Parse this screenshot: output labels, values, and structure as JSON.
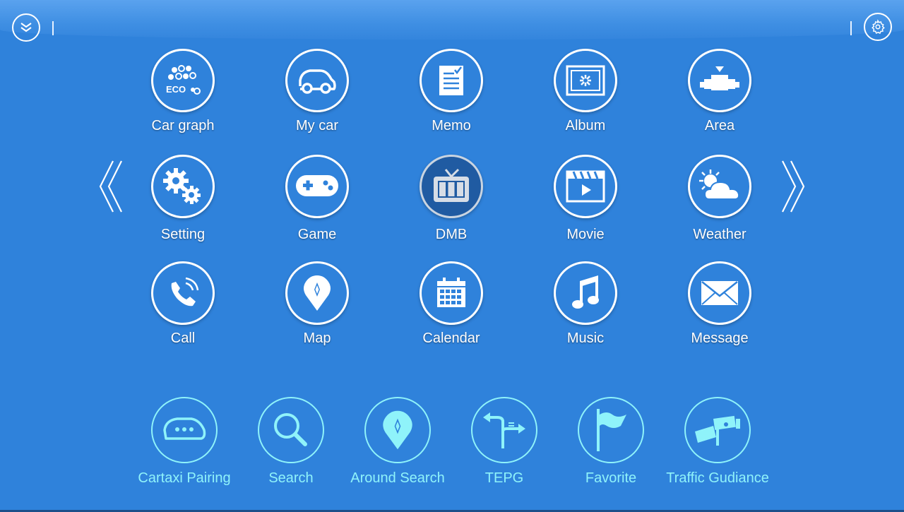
{
  "topbar": {
    "expand_icon": "double-chevron-down-icon",
    "settings_icon": "gear-icon"
  },
  "nav": {
    "prev_icon": "chevron-left-icon",
    "next_icon": "chevron-right-icon"
  },
  "apps": [
    {
      "label": "Car graph",
      "icon": "eco-icon"
    },
    {
      "label": "My car",
      "icon": "car-outline-icon"
    },
    {
      "label": "Memo",
      "icon": "memo-icon"
    },
    {
      "label": "Album",
      "icon": "album-icon"
    },
    {
      "label": "Area",
      "icon": "area-icon"
    },
    {
      "label": "Setting",
      "icon": "gears-icon"
    },
    {
      "label": "Game",
      "icon": "gamepad-icon"
    },
    {
      "label": "DMB",
      "icon": "tv-icon",
      "selected": true
    },
    {
      "label": "Movie",
      "icon": "clapperboard-icon"
    },
    {
      "label": "Weather",
      "icon": "weather-icon"
    },
    {
      "label": "Call",
      "icon": "phone-icon"
    },
    {
      "label": "Map",
      "icon": "map-pin-icon"
    },
    {
      "label": "Calendar",
      "icon": "calendar-icon"
    },
    {
      "label": "Music",
      "icon": "music-note-icon"
    },
    {
      "label": "Message",
      "icon": "envelope-icon"
    }
  ],
  "quick_actions": [
    {
      "label": "Cartaxi Pairing",
      "icon": "car-chat-icon"
    },
    {
      "label": "Search",
      "icon": "magnifier-icon"
    },
    {
      "label": "Around Search",
      "icon": "pin-compass-icon"
    },
    {
      "label": "TEPG",
      "icon": "route-signs-icon"
    },
    {
      "label": "Favorite",
      "icon": "flag-icon"
    },
    {
      "label": "Traffic Gudiance",
      "icon": "traffic-camera-icon"
    }
  ],
  "colors": {
    "background": "#2f82db",
    "accent": "#8ff3fa",
    "active": "#205ba2"
  }
}
